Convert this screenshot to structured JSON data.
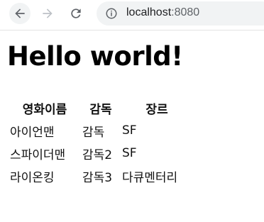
{
  "browser": {
    "url_host": "localhost",
    "url_port": ":8080"
  },
  "page": {
    "heading": "Hello world!",
    "table": {
      "headers": [
        "영화이름",
        "감독",
        "장르"
      ],
      "rows": [
        [
          "아이언맨",
          "감독",
          "SF"
        ],
        [
          "스파이더맨",
          "감독2",
          "SF"
        ],
        [
          "라이온킹",
          "감독3",
          "다큐멘터리"
        ]
      ]
    }
  }
}
